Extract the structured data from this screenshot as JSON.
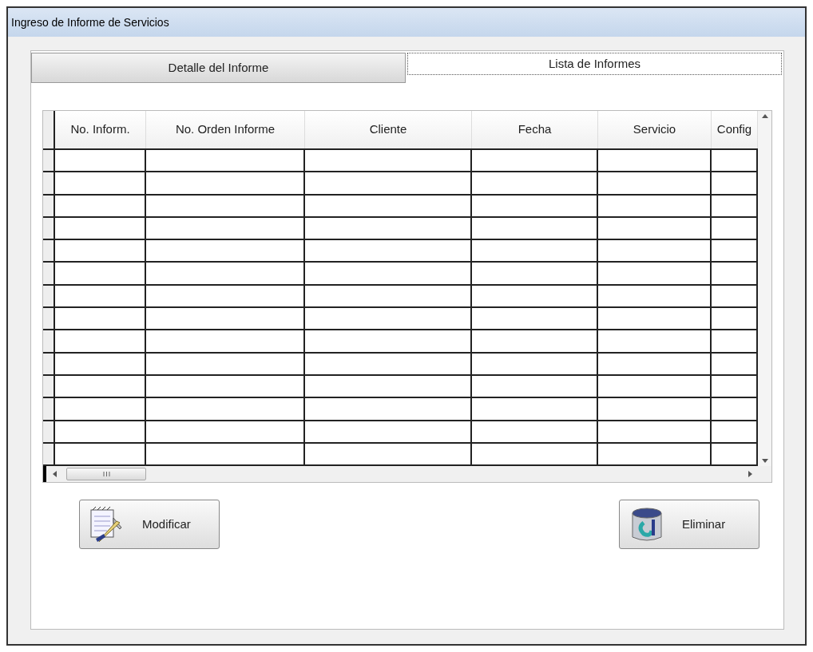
{
  "window": {
    "title": "Ingreso de Informe de Servicios"
  },
  "tabs": [
    {
      "label": "Detalle del Informe",
      "selected": false
    },
    {
      "label": "Lista de Informes",
      "selected": true
    }
  ],
  "table": {
    "columns": [
      "No. Inform.",
      "No. Orden Informe",
      "Cliente",
      "Fecha",
      "Servicio",
      "Config"
    ]
  },
  "buttons": [
    {
      "label": "Modificar",
      "kind": "edit"
    },
    {
      "label": "Eliminar",
      "kind": "delete"
    }
  ]
}
